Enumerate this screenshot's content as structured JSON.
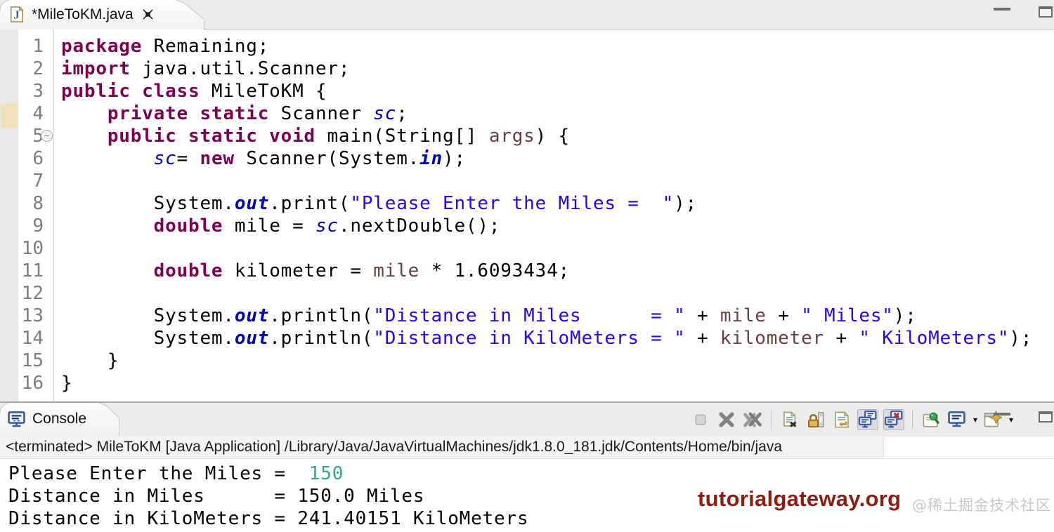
{
  "editor": {
    "tab_title": "*MileToKM.java",
    "highlighted_line": 4,
    "folded_line": 5,
    "fold_glyph": "−",
    "code_lines": [
      {
        "n": "1",
        "tokens": [
          {
            "t": "kw",
            "x": "package"
          },
          {
            "t": "p",
            "x": " Remaining;"
          }
        ]
      },
      {
        "n": "2",
        "tokens": [
          {
            "t": "kw",
            "x": "import"
          },
          {
            "t": "p",
            "x": " java.util.Scanner;"
          }
        ]
      },
      {
        "n": "3",
        "tokens": [
          {
            "t": "kw",
            "x": "public class"
          },
          {
            "t": "p",
            "x": " MileToKM {"
          }
        ]
      },
      {
        "n": "4",
        "tokens": [
          {
            "t": "p",
            "x": "    "
          },
          {
            "t": "kw",
            "x": "private static"
          },
          {
            "t": "p",
            "x": " Scanner "
          },
          {
            "t": "sf",
            "x": "sc"
          },
          {
            "t": "p",
            "x": ";"
          }
        ]
      },
      {
        "n": "5",
        "tokens": [
          {
            "t": "p",
            "x": "    "
          },
          {
            "t": "kw",
            "x": "public static void"
          },
          {
            "t": "p",
            "x": " main(String[] "
          },
          {
            "t": "v",
            "x": "args"
          },
          {
            "t": "p",
            "x": ") {"
          }
        ]
      },
      {
        "n": "6",
        "tokens": [
          {
            "t": "p",
            "x": "        "
          },
          {
            "t": "sf",
            "x": "sc"
          },
          {
            "t": "p",
            "x": "= "
          },
          {
            "t": "kw",
            "x": "new"
          },
          {
            "t": "p",
            "x": " Scanner(System."
          },
          {
            "t": "sfb",
            "x": "in"
          },
          {
            "t": "p",
            "x": ");"
          }
        ]
      },
      {
        "n": "7",
        "tokens": []
      },
      {
        "n": "8",
        "tokens": [
          {
            "t": "p",
            "x": "        System."
          },
          {
            "t": "sfb",
            "x": "out"
          },
          {
            "t": "p",
            "x": ".print("
          },
          {
            "t": "s",
            "x": "\"Please Enter the Miles =  \""
          },
          {
            "t": "p",
            "x": ");"
          }
        ]
      },
      {
        "n": "9",
        "tokens": [
          {
            "t": "p",
            "x": "        "
          },
          {
            "t": "kw",
            "x": "double"
          },
          {
            "t": "p",
            "x": " mile = "
          },
          {
            "t": "sf",
            "x": "sc"
          },
          {
            "t": "p",
            "x": ".nextDouble();"
          }
        ]
      },
      {
        "n": "10",
        "tokens": []
      },
      {
        "n": "11",
        "tokens": [
          {
            "t": "p",
            "x": "        "
          },
          {
            "t": "kw",
            "x": "double"
          },
          {
            "t": "p",
            "x": " kilometer = "
          },
          {
            "t": "v",
            "x": "mile"
          },
          {
            "t": "p",
            "x": " * 1.6093434;"
          }
        ]
      },
      {
        "n": "12",
        "tokens": []
      },
      {
        "n": "13",
        "tokens": [
          {
            "t": "p",
            "x": "        System."
          },
          {
            "t": "sfb",
            "x": "out"
          },
          {
            "t": "p",
            "x": ".println("
          },
          {
            "t": "s",
            "x": "\"Distance in Miles      = \""
          },
          {
            "t": "p",
            "x": " + "
          },
          {
            "t": "v",
            "x": "mile"
          },
          {
            "t": "p",
            "x": " + "
          },
          {
            "t": "s",
            "x": "\" Miles\""
          },
          {
            "t": "p",
            "x": ");"
          }
        ]
      },
      {
        "n": "14",
        "tokens": [
          {
            "t": "p",
            "x": "        System."
          },
          {
            "t": "sfb",
            "x": "out"
          },
          {
            "t": "p",
            "x": ".println("
          },
          {
            "t": "s",
            "x": "\"Distance in KiloMeters = \""
          },
          {
            "t": "p",
            "x": " + "
          },
          {
            "t": "v",
            "x": "kilometer"
          },
          {
            "t": "p",
            "x": " + "
          },
          {
            "t": "s",
            "x": "\" KiloMeters\""
          },
          {
            "t": "p",
            "x": ");"
          }
        ]
      },
      {
        "n": "15",
        "tokens": [
          {
            "t": "p",
            "x": "    }"
          }
        ]
      },
      {
        "n": "16",
        "tokens": [
          {
            "t": "p",
            "x": "}"
          }
        ]
      }
    ]
  },
  "console": {
    "tab_label": "Console",
    "status_text": "<terminated> MileToKM [Java Application] /Library/Java/JavaVirtualMachines/jdk1.8.0_181.jdk/Contents/Home/bin/java",
    "output_lines": [
      {
        "segments": [
          {
            "x": "Please Enter the Miles =  ",
            "c": "stdout"
          },
          {
            "x": "150",
            "c": "stdin"
          }
        ]
      },
      {
        "segments": [
          {
            "x": "Distance in Miles      = 150.0 Miles",
            "c": "stdout"
          }
        ]
      },
      {
        "segments": [
          {
            "x": "Distance in KiloMeters = 241.40151 KiloMeters",
            "c": "stdout"
          }
        ]
      }
    ],
    "toolbar_icons": [
      "terminate",
      "remove-launch",
      "remove-all-terminated",
      "clear-console",
      "scroll-lock",
      "word-wrap",
      "show-stdout-changes",
      "show-stderr-changes",
      "pin-console",
      "display-selected-console",
      "open-console",
      "minimize",
      "maximize"
    ]
  },
  "watermarks": {
    "brand": "tutorialgateway.org",
    "community": "@稀土掘金技术社区"
  },
  "colors": {
    "keyword": "#7B0052",
    "string": "#2A00FF",
    "static_field": "#0000C0",
    "variable_ref": "#6A3E3E",
    "stdin_green": "#2FAF7B",
    "brand_red": "#8F1C10"
  }
}
